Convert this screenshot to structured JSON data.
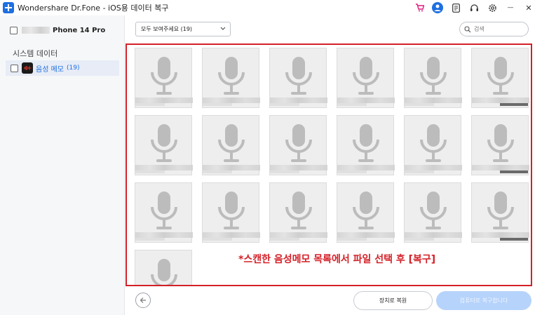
{
  "window": {
    "title": "Wondershare Dr.Fone - iOS용 데이터 복구",
    "icons": [
      "cart-icon",
      "user-avatar-icon",
      "notes-icon",
      "headset-icon",
      "settings-icon",
      "minimize-icon",
      "close-icon"
    ],
    "minimize_glyph": "—",
    "close_glyph": "✕"
  },
  "sidebar": {
    "device_name": "Phone 14 Pro",
    "section_label": "시스템 데이터",
    "category": {
      "label": "음성 메모",
      "count": "(19)"
    }
  },
  "toolbar": {
    "filter_value": "모두 보여주세요 (19)",
    "search_placeholder": "검색"
  },
  "grid": {
    "tiles": [
      {
        "type": "voice-memo"
      },
      {
        "type": "voice-memo"
      },
      {
        "type": "voice-memo"
      },
      {
        "type": "voice-memo"
      },
      {
        "type": "voice-memo"
      },
      {
        "type": "voice-memo"
      },
      {
        "type": "voice-memo"
      },
      {
        "type": "voice-memo"
      },
      {
        "type": "voice-memo"
      },
      {
        "type": "voice-memo"
      },
      {
        "type": "voice-memo"
      },
      {
        "type": "voice-memo"
      },
      {
        "type": "voice-memo"
      },
      {
        "type": "voice-memo"
      },
      {
        "type": "voice-memo"
      },
      {
        "type": "voice-memo"
      },
      {
        "type": "voice-memo"
      },
      {
        "type": "voice-memo"
      },
      {
        "type": "voice-memo"
      }
    ]
  },
  "annotation": "*스캔한 음성메모 목록에서 파일 선택 후 [복구]",
  "footer": {
    "restore_device_label": "장치로 복원",
    "restore_pc_label": "컴퓨터로 복구합니다"
  },
  "colors": {
    "accent": "#1e6fe0",
    "highlight_border": "#d42027",
    "disabled_button": "#b6d3fb"
  }
}
